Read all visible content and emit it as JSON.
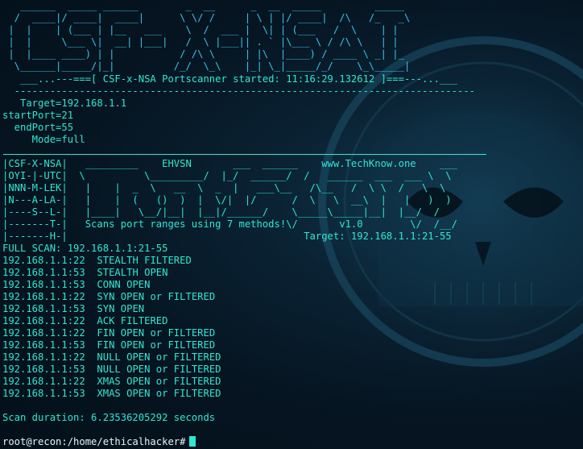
{
  "banner_lines": [
    "   ______  _____ ______        _  __      _  __  _____         _____ ",
    "  /  ____|/ ____|  ____|      \\ \\/ /     | \\ | |/ ____|  /\\   /_   _\\",
    " |  |    | (___ | |__   ___    \\  /  ___ |  \\| | (___   /  \\    | |  ",
    " |  |     \\___ \\|  __| |___|   /  \\ |___|| . ` |\\___ \\ / /\\ \\   | |  ",
    " |  |____ ____) | |           / /\\ \\     | |\\  |____) / ____ \\ _| |_ ",
    "  \\______|_____/|_|          /_/  \\_\\    |_| \\_|_____/_/    \\_\\_____|",
    "                          \\/                                    \\/   "
  ],
  "start_banner": "   ___...---===[ CSF-x-NSA Portscanner started: 11:16:29.132612 ]===---...___",
  "dash_line": "  ------------------------------------------------------------------------------",
  "params": [
    "   Target=192.168.1.1",
    "startPort=21",
    "  endPort=55",
    "     Mode=full"
  ],
  "logo_lines": [
    "|CSF-X-NSA|   _________    EHVSN       ___  ______    www.TechKnow.one    ___",
    "|OYI-|-UTC|  \\          \\_________/  |_/  ______/  /   ______  ___  ___ \\  \\",
    "|NNN-M-LEK|   |    |  _  \\   __  \\  _  |   ___\\__   /\\__   /  \\ \\  /   \\  \\",
    "|N---A-LA-|   |    |  (   ()  )  |  \\/|  |/      /  \\   \\  __\\  |   |   )  )",
    "|----S--L-|   |____|   \\__/|__|  |__|/______/    \\_____\\_____|__|  |__/  /",
    "|-------T-|   Scans port ranges using 7 methods!\\/       v1.0        \\/  /__/",
    "|-------H-|                                        Target: 192.168.1.1:21-55"
  ],
  "scan_header": "FULL SCAN: 192.168.1.1:21-55",
  "results": [
    {
      "host": "192.168.1.1:22",
      "status": "STEALTH FILTERED"
    },
    {
      "host": "192.168.1.1:53",
      "status": "STEALTH OPEN"
    },
    {
      "host": "192.168.1.1:53",
      "status": "CONN OPEN"
    },
    {
      "host": "192.168.1.1:22",
      "status": "SYN OPEN or FILTERED"
    },
    {
      "host": "192.168.1.1:53",
      "status": "SYN OPEN"
    },
    {
      "host": "192.168.1.1:22",
      "status": "ACK FILTERED"
    },
    {
      "host": "192.168.1.1:22",
      "status": "FIN OPEN or FILTERED"
    },
    {
      "host": "192.168.1.1:53",
      "status": "FIN OPEN or FILTERED"
    },
    {
      "host": "192.168.1.1:22",
      "status": "NULL OPEN or FILTERED"
    },
    {
      "host": "192.168.1.1:53",
      "status": "NULL OPEN or FILTERED"
    },
    {
      "host": "192.168.1.1:22",
      "status": "XMAS OPEN or FILTERED"
    },
    {
      "host": "192.168.1.1:53",
      "status": "XMAS OPEN or FILTERED"
    }
  ],
  "duration": "Scan duration: 6.23536205292 seconds",
  "prompt": "root@recon:/home/ethicalhacker#",
  "colors": {
    "text": "#2ee8d2",
    "banner": "#38c4ea",
    "prompt": "#e8f4f4",
    "background": "#03101a"
  }
}
